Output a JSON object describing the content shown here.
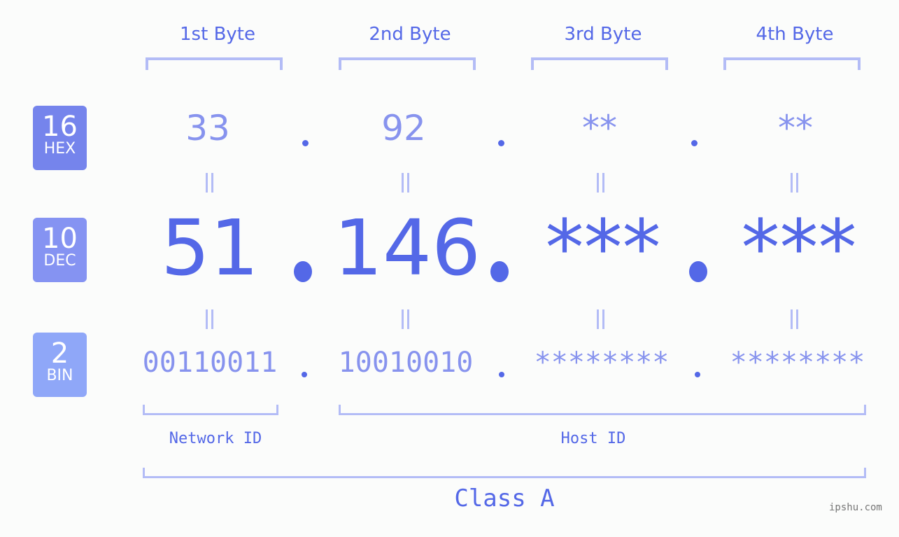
{
  "headers": [
    "1st Byte",
    "2nd Byte",
    "3rd Byte",
    "4th Byte"
  ],
  "badges": [
    {
      "num": "16",
      "label": "HEX",
      "color": "#7584ec"
    },
    {
      "num": "10",
      "label": "DEC",
      "color": "#8593f2"
    },
    {
      "num": "2",
      "label": "BIN",
      "color": "#8fa7f8"
    }
  ],
  "hex": [
    "33",
    "92",
    "**",
    "**"
  ],
  "dec": [
    "51",
    "146",
    "***",
    "***"
  ],
  "bin": [
    "00110011",
    "10010010",
    "********",
    "********"
  ],
  "network_id_label": "Network ID",
  "host_id_label": "Host ID",
  "class_label": "Class A",
  "watermark": "ipshu.com",
  "colors": {
    "accent": "#5468e7",
    "light": "#8793ee",
    "bracket": "#b3bcf6"
  }
}
